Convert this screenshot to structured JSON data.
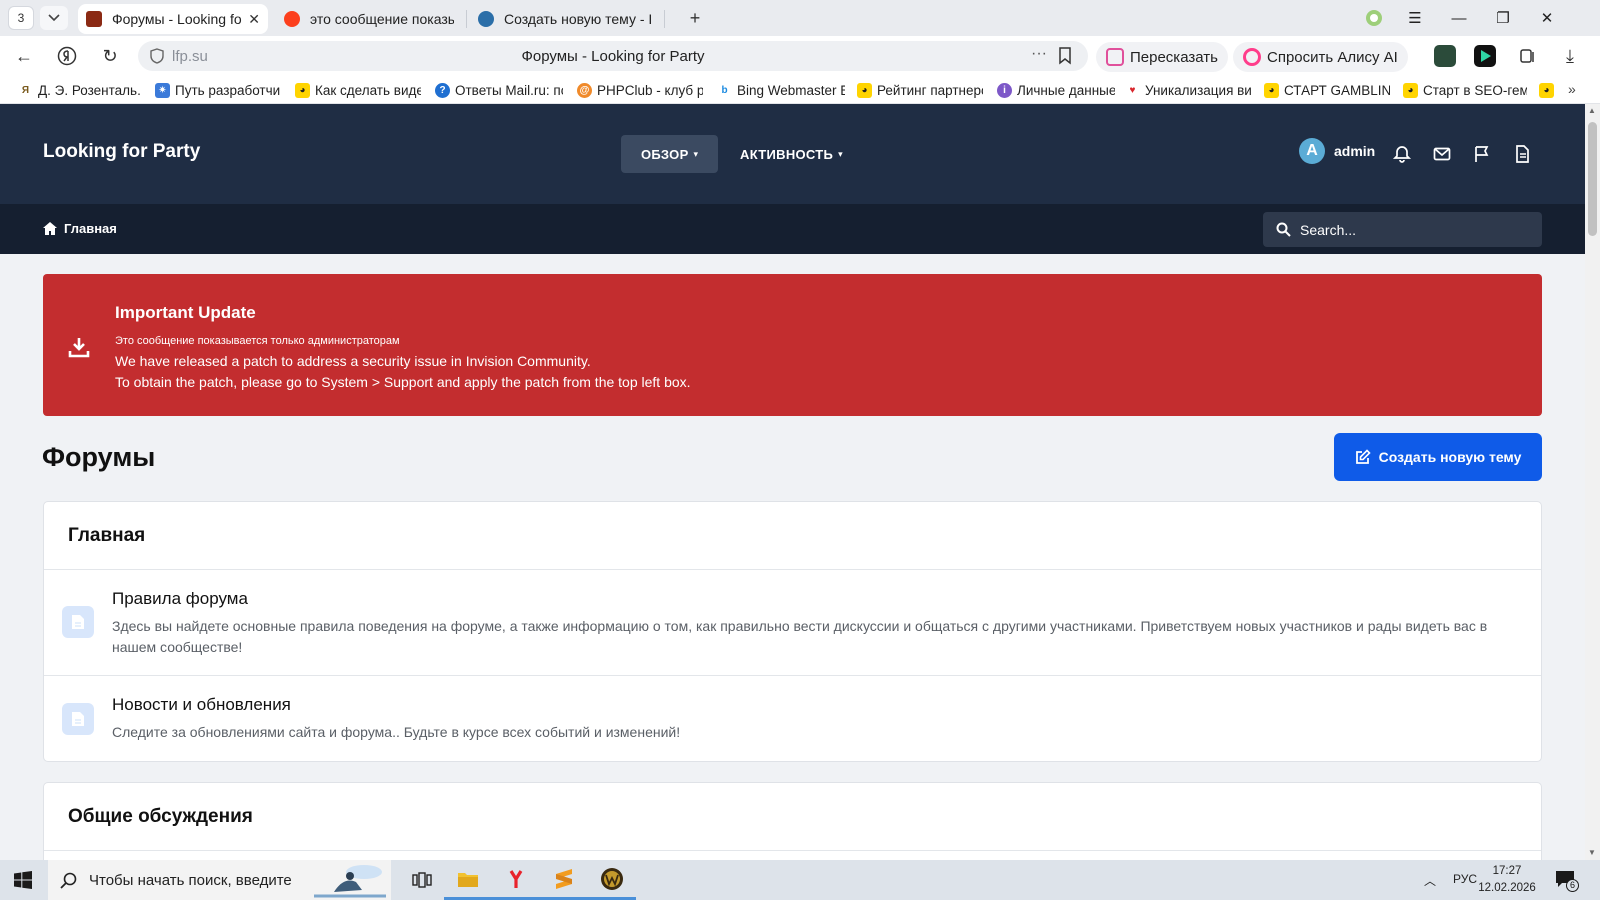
{
  "browser": {
    "tab_count": "3",
    "tabs": [
      {
        "title": "Форумы - Looking for Party",
        "active": true
      },
      {
        "title": "это сообщение показывается только администраторам",
        "active": false
      },
      {
        "title": "Создать новую тему - IPB",
        "active": false
      }
    ],
    "url": "lfp.su",
    "page_title": "Форумы - Looking for Party",
    "retell_label": "Пересказать",
    "alice_label": "Спросить Алису AI",
    "bookmarks": [
      "Д. Э. Розенталь. С",
      "Путь разработчика",
      "Как сделать видео",
      "Ответы Mail.ru: по",
      "PHPClub - клуб р",
      "Bing Webmaster E",
      "Рейтинг партнерс",
      "Личные данные",
      "Уникализация ви",
      "СТАРТ GAMBLING",
      "Старт в SEO-гем"
    ]
  },
  "site": {
    "brand": "Looking for Party",
    "nav": [
      {
        "label": "ОБЗОР",
        "active": true
      },
      {
        "label": "АКТИВНОСТЬ",
        "active": false
      }
    ],
    "user": {
      "initial": "A",
      "name": "admin"
    },
    "breadcrumb": "Главная",
    "search_placeholder": "Search...",
    "alert": {
      "title": "Important Update",
      "subtitle": "Это сообщение показывается только администраторам",
      "line1": "We have released a patch to address a security issue in Invision Community.",
      "line2": "To obtain the patch, please go to System > Support and apply the patch from the top left box."
    },
    "page_title": "Форумы",
    "create_button": "Создать новую тему",
    "categories": [
      {
        "name": "Главная",
        "forums": [
          {
            "title": "Правила форума",
            "description": "Здесь вы найдете основные правила поведения на форуме, а также информацию о том, как правильно вести дискуссии и общаться с другими участниками. Приветствуем новых участников и рады видеть вас в нашем сообществе!"
          },
          {
            "title": "Новости и обновления",
            "description": "Следите за обновлениями сайта и форума.. Будьте в курсе всех событий и изменений!"
          }
        ]
      },
      {
        "name": "Общие обсуждения",
        "forums": []
      }
    ]
  },
  "taskbar": {
    "search_text": "Чтобы начать поиск, введите",
    "language": "РУС",
    "time": "17:27",
    "date": "12.02.2026",
    "notification_count": "6"
  },
  "colors": {
    "header": "#1f2d44",
    "subbar": "#151f30",
    "alert": "#c32d2f",
    "primary_button": "#0f5be8"
  }
}
